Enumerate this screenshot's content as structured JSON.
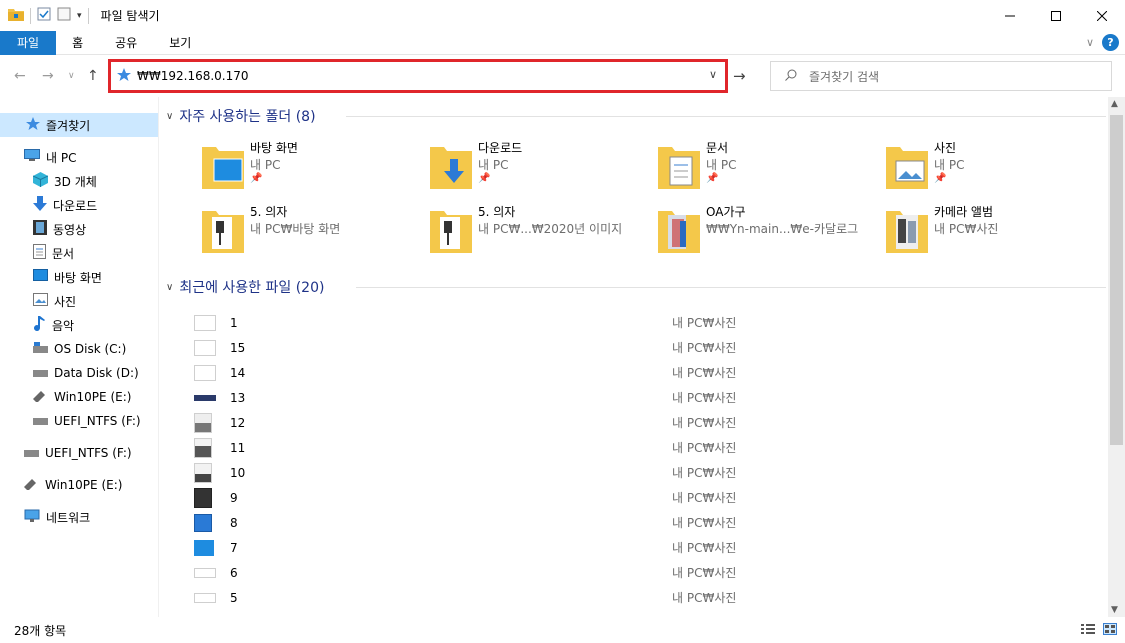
{
  "window": {
    "title": "파일 탐색기"
  },
  "ribbon": {
    "tabs": [
      "파일",
      "홈",
      "공유",
      "보기"
    ]
  },
  "nav": {
    "address": "₩₩192.168.0.170",
    "search_placeholder": "즐겨찾기 검색"
  },
  "sidebar": {
    "items": [
      {
        "label": "즐겨찾기",
        "icon": "star-icon",
        "selected": true
      },
      {
        "label": "내 PC",
        "icon": "pc-icon"
      },
      {
        "label": "3D 개체",
        "icon": "3d-objects-icon"
      },
      {
        "label": "다운로드",
        "icon": "download-icon"
      },
      {
        "label": "동영상",
        "icon": "video-icon"
      },
      {
        "label": "문서",
        "icon": "document-icon"
      },
      {
        "label": "바탕 화면",
        "icon": "desktop-icon"
      },
      {
        "label": "사진",
        "icon": "pictures-icon"
      },
      {
        "label": "음악",
        "icon": "music-icon"
      },
      {
        "label": "OS Disk (C:)",
        "icon": "drive-icon"
      },
      {
        "label": "Data Disk (D:)",
        "icon": "drive-icon"
      },
      {
        "label": "Win10PE (E:)",
        "icon": "usb-drive-icon"
      },
      {
        "label": "UEFI_NTFS (F:)",
        "icon": "drive-icon"
      },
      {
        "label": "UEFI_NTFS (F:)",
        "icon": "drive-icon"
      },
      {
        "label": "Win10PE (E:)",
        "icon": "usb-drive-icon"
      },
      {
        "label": "네트워크",
        "icon": "network-icon"
      }
    ]
  },
  "frequent": {
    "heading": "자주 사용하는 폴더 (8)",
    "folders": [
      {
        "name": "바탕 화면",
        "location": "내 PC",
        "pinned": true,
        "icon": "desktop-folder-icon"
      },
      {
        "name": "다운로드",
        "location": "내 PC",
        "pinned": true,
        "icon": "download-folder-icon"
      },
      {
        "name": "문서",
        "location": "내 PC",
        "pinned": true,
        "icon": "document-folder-icon"
      },
      {
        "name": "사진",
        "location": "내 PC",
        "pinned": true,
        "icon": "pictures-folder-icon"
      },
      {
        "name": "5. 의자",
        "location": "내 PC₩바탕 화면",
        "pinned": false,
        "icon": "folder-icon"
      },
      {
        "name": "5. 의자",
        "location": "내 PC₩...₩2020년 이미지",
        "pinned": false,
        "icon": "folder-icon"
      },
      {
        "name": "OA가구",
        "location": "₩₩Yn-main...₩e-카달로그",
        "pinned": false,
        "icon": "folder-icon"
      },
      {
        "name": "카메라 앨범",
        "location": "내 PC₩사진",
        "pinned": false,
        "icon": "folder-icon"
      }
    ]
  },
  "recent": {
    "heading": "최근에 사용한 파일 (20)",
    "files": [
      {
        "name": "1",
        "location": "내 PC₩사진"
      },
      {
        "name": "15",
        "location": "내 PC₩사진"
      },
      {
        "name": "14",
        "location": "내 PC₩사진"
      },
      {
        "name": "13",
        "location": "내 PC₩사진"
      },
      {
        "name": "12",
        "location": "내 PC₩사진"
      },
      {
        "name": "11",
        "location": "내 PC₩사진"
      },
      {
        "name": "10",
        "location": "내 PC₩사진"
      },
      {
        "name": "9",
        "location": "내 PC₩사진"
      },
      {
        "name": "8",
        "location": "내 PC₩사진"
      },
      {
        "name": "7",
        "location": "내 PC₩사진"
      },
      {
        "name": "6",
        "location": "내 PC₩사진"
      },
      {
        "name": "5",
        "location": "내 PC₩사진"
      }
    ]
  },
  "status": {
    "item_count": "28개 항목"
  },
  "colors": {
    "accent": "#1979ca",
    "highlight": "#e0262b",
    "selection": "#cce8ff",
    "heading": "#1e3287"
  }
}
